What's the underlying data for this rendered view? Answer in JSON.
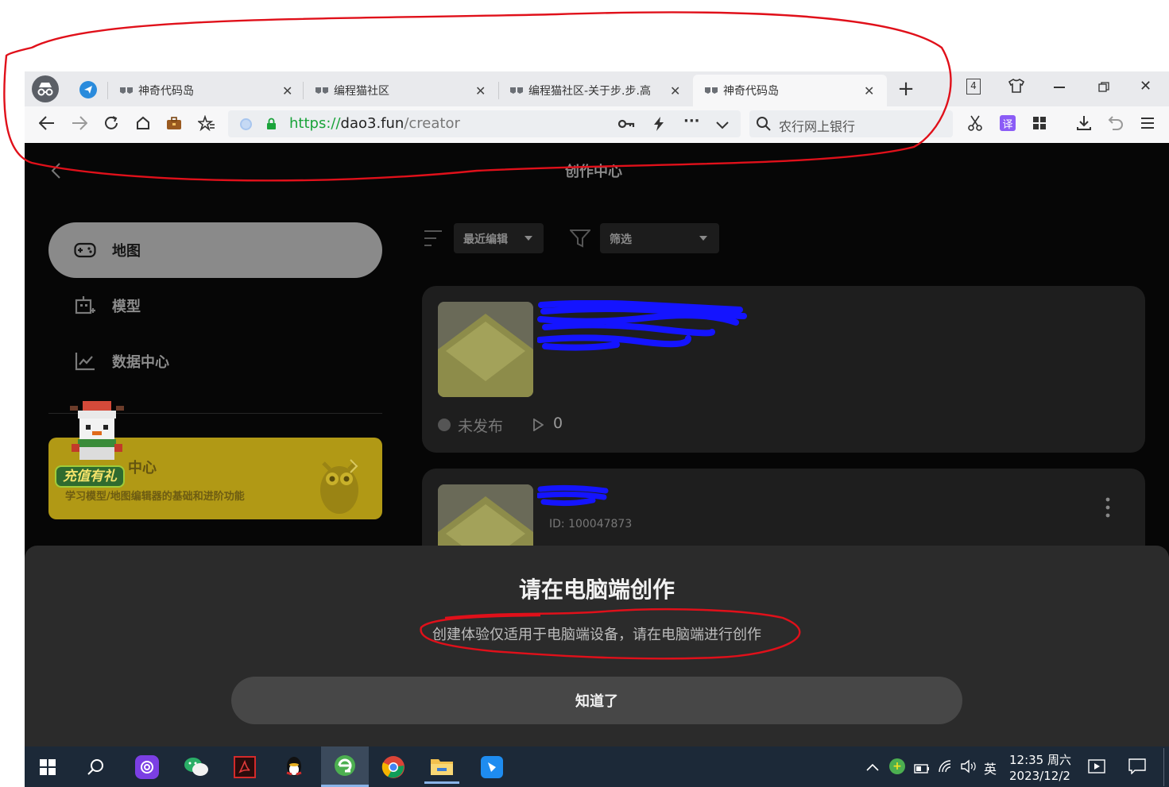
{
  "browser": {
    "tabs": [
      {
        "title": "神奇代码岛",
        "active": false
      },
      {
        "title": "编程猫社区",
        "active": false
      },
      {
        "title": "编程猫社区-关于步.步.高",
        "active": false
      },
      {
        "title": "神奇代码岛",
        "active": true
      }
    ],
    "tab_count": "4",
    "url_scheme": "https://",
    "url_host": "dao3.fun",
    "url_path": "/creator",
    "search_placeholder": "农行网上银行",
    "translate_label": "译"
  },
  "page": {
    "title": "创作中心",
    "sidebar": {
      "items": [
        {
          "label": "地图",
          "icon": "gamepad-icon",
          "selected": true
        },
        {
          "label": "模型",
          "icon": "model-icon",
          "selected": false
        },
        {
          "label": "数据中心",
          "icon": "chart-icon",
          "selected": false
        }
      ],
      "banner": {
        "title": "中心",
        "subtitle": "学习模型/地图编辑器的基础和进阶功能",
        "badge": "充值有礼"
      }
    },
    "filters": {
      "sort_label": "最近编辑",
      "filter_label": "筛选"
    },
    "cards": [
      {
        "status": "未发布",
        "plays": "0"
      },
      {
        "id": "ID: 100047873"
      }
    ]
  },
  "modal": {
    "title": "请在电脑端创作",
    "message": "创建体验仅适用于电脑端设备，请在电脑端进行创作",
    "button": "知道了"
  },
  "taskbar": {
    "ime": "英",
    "time": "12:35 周六",
    "date": "2023/12/2"
  },
  "colors": {
    "url_green": "#1aa33a",
    "annotation_red": "#e0101a",
    "scribble_blue": "#1010ff",
    "banner_yellow": "#c8aa12"
  }
}
